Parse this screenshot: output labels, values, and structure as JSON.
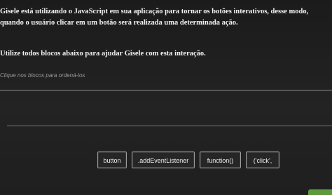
{
  "question": {
    "line1": "Gisele está utilizando o JavaScript em sua aplicação para tornar os botões interativos, desse modo,",
    "line2": "quando o usuário clicar em um botão será realizada uma determinada ação."
  },
  "instruction": "Utilize todos blocos abaixo para ajudar Gisele com esta interação.",
  "hint": "Clique nos blocos para ordená-los",
  "blocks": [
    "button",
    ".addEventListener",
    "function()",
    "('click',"
  ],
  "colors": {
    "background": "#1e1e1e",
    "text": "#f3f3f3",
    "hint": "#9a9a9a",
    "block_border": "#9e9e9e",
    "accent_green": "#5d9a3c"
  }
}
